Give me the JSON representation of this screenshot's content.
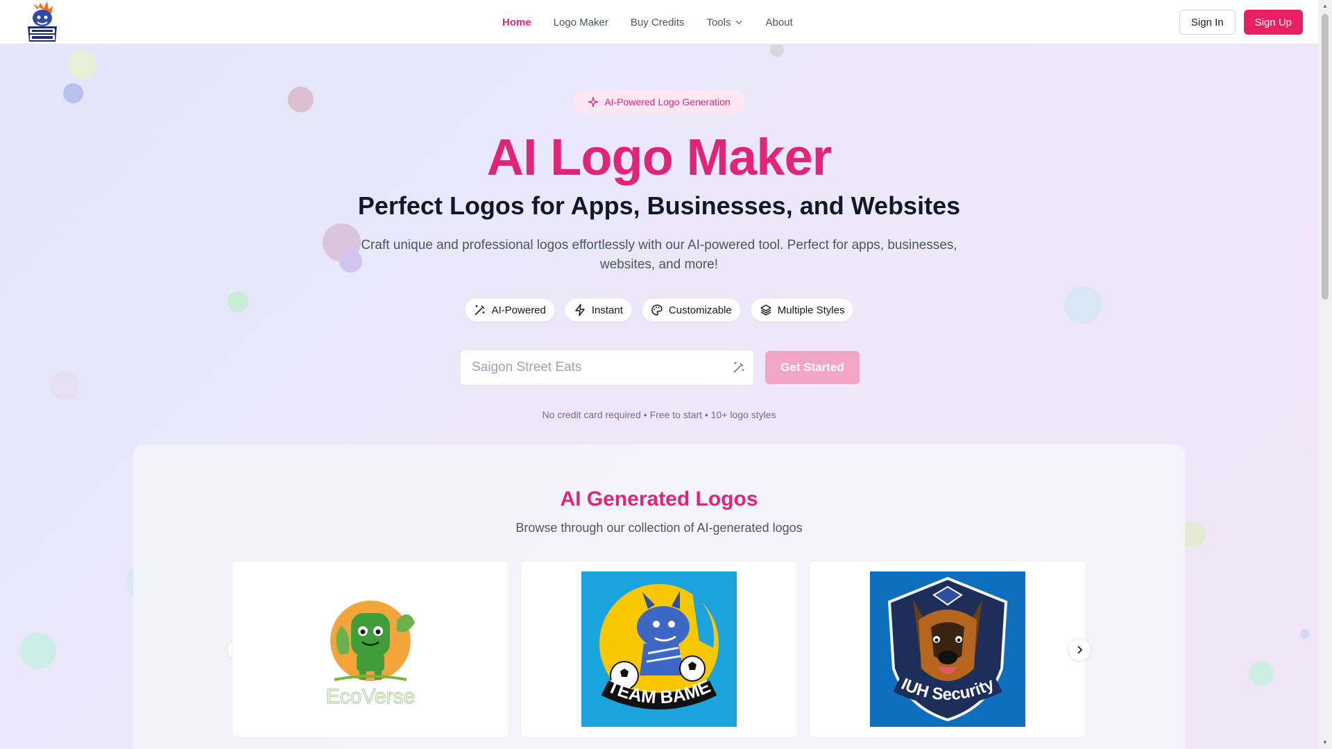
{
  "header": {
    "brand_logo_name": "brand-logo",
    "nav": [
      {
        "label": "Home",
        "active": true
      },
      {
        "label": "Logo Maker",
        "active": false
      },
      {
        "label": "Buy Credits",
        "active": false
      },
      {
        "label": "Tools",
        "active": false,
        "has_dropdown": true
      },
      {
        "label": "About",
        "active": false
      }
    ],
    "signin_label": "Sign In",
    "signup_label": "Sign Up"
  },
  "hero": {
    "badge": "AI-Powered Logo Generation",
    "title": "AI Logo Maker",
    "subtitle": "Perfect Logos for Apps, Businesses, and Websites",
    "description": "Craft unique and professional logos effortlessly with our AI-powered tool. Perfect for apps, businesses, websites, and more!",
    "features": [
      {
        "label": "AI-Powered",
        "icon": "wand-icon"
      },
      {
        "label": "Instant",
        "icon": "bolt-icon"
      },
      {
        "label": "Customizable",
        "icon": "palette-icon"
      },
      {
        "label": "Multiple Styles",
        "icon": "layers-icon"
      }
    ],
    "search_placeholder": "Saigon Street Eats",
    "get_started_label": "Get Started",
    "footnote": "No credit card required • Free to start • 10+ logo styles"
  },
  "gallery": {
    "title": "AI Generated Logos",
    "subtitle": "Browse through our collection of AI-generated logos",
    "logos": [
      {
        "text": "EcoVerse"
      },
      {
        "text": "TEAM BAME"
      },
      {
        "text": "IUH Security"
      }
    ]
  },
  "colors": {
    "accent": "#e0247a",
    "signup_bg": "#e91e63",
    "get_started_bg": "#f3a5c8",
    "badge_bg": "#fce7f3"
  }
}
